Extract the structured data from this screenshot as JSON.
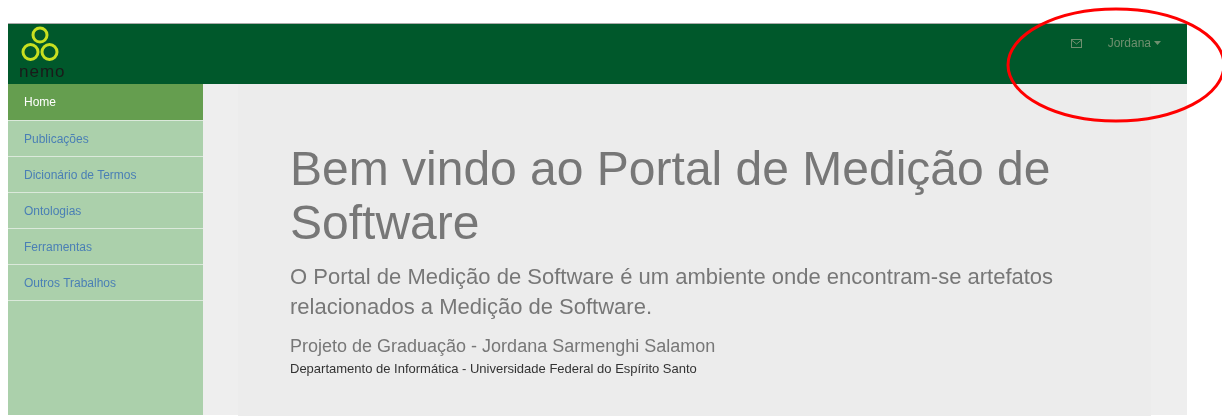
{
  "header": {
    "logo_text": "nemo",
    "user_menu": {
      "label": "Jordana"
    }
  },
  "sidebar": {
    "items": [
      {
        "label": "Home",
        "selected": true
      },
      {
        "label": "Publicações",
        "selected": false
      },
      {
        "label": "Dicionário de Termos",
        "selected": false
      },
      {
        "label": "Ontologias",
        "selected": false
      },
      {
        "label": "Ferramentas",
        "selected": false
      },
      {
        "label": "Outros Trabalhos",
        "selected": false
      }
    ]
  },
  "main": {
    "title": "Bem vindo ao Portal de Medição de Software",
    "lead": "O Portal de Medição de Software é um ambiente onde encontram-se artefatos relacionados a Medição de Software.",
    "project": "Projeto de Graduação - Jordana Sarmenghi Salamon",
    "department": "Departamento de Informática - Universidade Federal do Espírito Santo"
  }
}
